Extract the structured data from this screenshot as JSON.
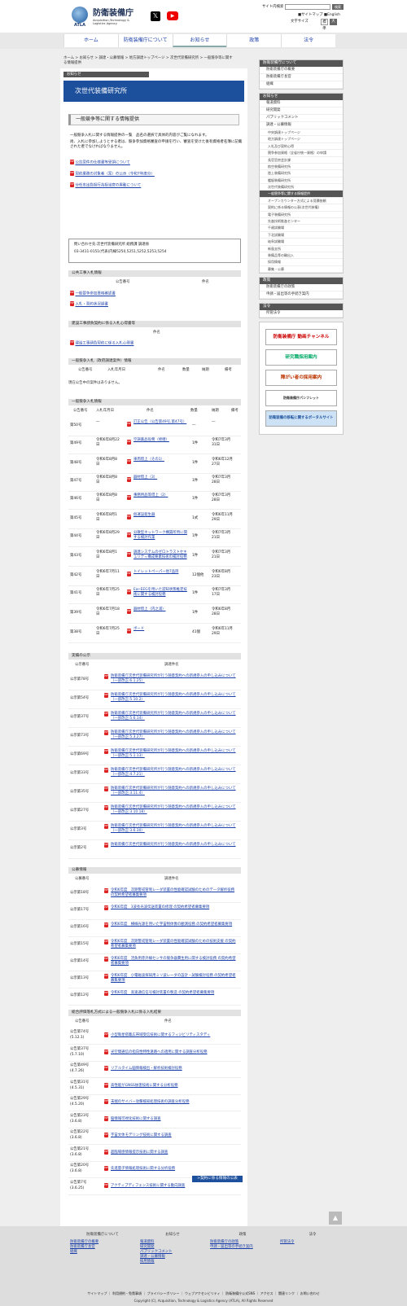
{
  "header": {
    "org_jp": "防衛装備庁",
    "org_en1": "Acquisition,Technology &",
    "org_en2": "Logistics Agency",
    "atla": "ATLA",
    "search_label": "サイト内検索",
    "search_btn": "検索",
    "sitemap": "サイトマップ",
    "english": "English",
    "fontsize_label": "文字サイズ",
    "fs_std": "標準",
    "fs_big": "大"
  },
  "nav": [
    "ホーム",
    "防衛装備庁について",
    "お知らせ",
    "政策",
    "法令"
  ],
  "breadcrumb": "ホーム > お知らせ > 調達・公募情報 > 地方調達トップページ > 次世代装備研究所 > 一般競争等に関する情報提供",
  "section_tab": "お知らせ",
  "banner_title": "次世代装備研究所",
  "page_title": "一般競争等に関する情報提供",
  "intro1": "一般競争入札に関する情報提供の一覧　品名の選択で具体的内容がご覧になれます。",
  "intro2": "尚、入札に参加しようとする者は、競争参加資格審査の申請を行い、審査を受けた後有資格者名簿に記載された者でなければなりません。",
  "links": [
    "公告案件の仕様書等受領について",
    "契約業務の対象者（案）の公示（令和7年度分）",
    "分任支出負担行為担当官の異動について"
  ],
  "contact1": "問い合わせ先:次世代装備研究所 総務課 調達係",
  "contact2": "03-3411-0151(代表)内線5250,5251,5252,5253,5254",
  "sec1": {
    "title": "公共工事入札情報",
    "h_no": "公告番号",
    "h_name": "件名",
    "links": [
      "一般競争参加資格確認書",
      "入札・契約状況調書"
    ]
  },
  "sec2": {
    "title": "建設工事請負契約に係る入札心得書等",
    "h_name": "件名",
    "links": [
      "建設工事請負契約に係る入札心得書"
    ]
  },
  "sec3": {
    "title": "一般競争入札（政府調達案件）情報",
    "heads": [
      "公告番号",
      "入札年月日",
      "件名",
      "数量",
      "納期",
      "備考"
    ],
    "none": "現在公告中の案件はありません。"
  },
  "sec4": {
    "title": "一般競争入札情報",
    "heads": [
      "公告番号",
      "入札年月日",
      "件名",
      "数量",
      "納期",
      "備考"
    ],
    "rows": [
      {
        "no": "第50号",
        "date": "―",
        "name": "訂正公告（公告第49号,第47号）",
        "qty": "―",
        "due": "―"
      },
      {
        "no": "第49号",
        "date": "令和6年8月22日",
        "name": "空調薬品役務（修繕）",
        "qty": "1件",
        "due": "令和7年3月31日"
      },
      {
        "no": "第48号",
        "date": "令和6年8月8日",
        "name": "車両借上（その1）",
        "qty": "1件",
        "due": "令和6年12月27日"
      },
      {
        "no": "第47号",
        "date": "令和6年8月8日",
        "name": "器材借上（3）",
        "qty": "1件",
        "due": "令和7年3月28日"
      },
      {
        "no": "第46号",
        "date": "令和6年8月8日",
        "name": "事務用品等借上（2）",
        "qty": "1件",
        "due": "令和7年3月28日"
      },
      {
        "no": "第45号",
        "date": "令和6年8月1日",
        "name": "仮運設発生器",
        "qty": "1式",
        "due": "令和6年11月29日"
      },
      {
        "no": "第44号",
        "date": "令和6年8月29日",
        "name": "分散型ネットワーク構築所用に関する検討作業",
        "qty": "1件",
        "due": "令和7年3月21日"
      },
      {
        "no": "第43号",
        "date": "令和6年8月1日",
        "name": "調達システムのゼロトラストセキュリティ構成要素技術の検討役務",
        "qty": "1件",
        "due": "令和7年3月21日"
      },
      {
        "no": "第42号",
        "date": "令和6年7月11日",
        "name": "トイレットペーパー他7品目",
        "qty": "12個他",
        "due": "令和6年8月23日"
      },
      {
        "no": "第41号",
        "date": "令和6年7月25日",
        "name": "Ear-EEGを用いた認知状態推定技術に関する検討役務",
        "qty": "1件",
        "due": "令和7年3月17日"
      },
      {
        "no": "第39号",
        "date": "令和6年7月18日",
        "name": "器材借上（内之浦）",
        "qty": "1件",
        "due": "令和6年8月28日"
      },
      {
        "no": "第38号",
        "date": "令和6年7月25日",
        "name": "ボード",
        "qty": "41個",
        "due": "令和6年11月29日"
      }
    ]
  },
  "sec5": {
    "title": "実績の公示",
    "heads": [
      "公示番号",
      "調達件名"
    ],
    "rows": [
      {
        "no": "公示第78号",
        "name": "防衛装備庁次世代装備研究所が行う随意契約への新規参入の申し込みについて（一部改正:6.1.25）"
      },
      {
        "no": "公示第54号",
        "name": "防衛装備庁次世代装備研究所が行う随意契約への新規参入の申し込みについて（一部改正:5.10.2）"
      },
      {
        "no": "公示第37号",
        "name": "防衛装備庁次世代装備研究所が行う随意契約への新規参入の申し込みについて（一部改正:5.6.14）"
      },
      {
        "no": "公示第73号",
        "name": "防衛装備庁次世代装備研究所が行う随意契約への新規参入の申し込みについて（一部改正:5.3.27）"
      },
      {
        "no": "公示第69号",
        "name": "防衛装備庁次世代装備研究所が行う随意契約への新規参入の申し込みについて（一部改正:5.1.13）"
      },
      {
        "no": "公示第33号",
        "name": "防衛装備庁次世代装備研究所が行う随意契約への新規参入の申し込みについて（一部改正:4.7.21）"
      },
      {
        "no": "公示第35号",
        "name": "防衛装備庁次世代装備研究所が行う随意契約への新規参入の申し込みについて（一部改正:3.11.4）"
      },
      {
        "no": "公示第27号",
        "name": "防衛装備庁次世代装備研究所が行う随意契約への新規参入の申し込みについて（一部改正:3.10.18）"
      },
      {
        "no": "公示第3号",
        "name": "防衛装備庁次世代装備研究所が行う随意契約への新規参入の申し込みについて（一部改正:3.6.30）"
      },
      {
        "no": "公示第2号",
        "name": "防衛装備庁次世代装備研究所が行う随意契約への新規参入の申し込みについて"
      }
    ]
  },
  "sec6": {
    "title": "公募情報",
    "heads": [
      "公募番号",
      "調達件名"
    ],
    "rows": [
      {
        "no": "公示第18号",
        "name": "令和6年度　次期警戒管制レーダ装置の性能確認試験のためのデータ解析役務 の契約希望者募集要項"
      },
      {
        "no": "公示第17号",
        "name": "令和6年度　3波長光波伝送装置の修理 の契約希望者募集要項"
      },
      {
        "no": "公示第16号",
        "name": "令和6年度　横線光源を用いた宇宙物体像の観測役務 の契約希望者募集要項"
      },
      {
        "no": "公示第15号",
        "name": "令和6年度　次期警戒管制レーダ装置の性能確認試験のための技術支援 の契約希望者募集要項"
      },
      {
        "no": "公示第14号",
        "name": "令和6年度　活魚用赤外線センサの競争器費生用に関する検討役務 の契約希望者募集要項"
      },
      {
        "no": "公示第13号",
        "name": "令和6年度　小電磁波探知用ミリ波レーダの設計・試験検討役務 の契約希望者募集要項"
      },
      {
        "no": "公示第12号",
        "name": "令和6年度　高速通信信号検討装置の製造 の契約希望者募集要項"
      }
    ]
  },
  "sec7": {
    "title": "総合評価落札方式による一般競争入札に係る入札結果",
    "heads": [
      "公告番号",
      "件名"
    ],
    "rows": [
      {
        "no": "公告第74号",
        "date": "(5.12.1)",
        "name": "小型衛星搭載広帯域受信技術に関するフィジビリティスタディ"
      },
      {
        "no": "公告第37号",
        "date": "(5.7.10)",
        "name": "光空間通信の指向性特性遠路への適用に関する調査分析役務"
      },
      {
        "no": "公告第49号",
        "date": "(4.7.26)",
        "name": "リアルタイム脳情報検出・解析技術検討役務"
      },
      {
        "no": "公告第31号",
        "date": "(4.5.31)",
        "name": "高性能がGNSS妨害技術に関する分析役務"
      },
      {
        "no": "公告第29号",
        "date": "(4.5.20)",
        "name": "末端のサイバー攻撃検知処理技術の調査分析役務"
      },
      {
        "no": "公告第23号",
        "date": "(3.6.8)",
        "name": "脳情報可視化技術に関する調査"
      },
      {
        "no": "公告第22号",
        "date": "(3.6.8)",
        "name": "字宙文体モデリング技術に関する調査"
      },
      {
        "no": "公告第21号",
        "date": "(3.6.8)",
        "name": "超臨場感情報提示技術に関する調査"
      },
      {
        "no": "公告第20号",
        "date": "(3.6.8)",
        "name": "先進量子情報処理技術に関する分析役務"
      },
      {
        "no": "公告第7号",
        "date": "(3.6.25)",
        "name": "アクティブディフェンス技術に関する動向調査"
      }
    ]
  },
  "contract_btn": ">契約に係る情報の公表",
  "sidebar": {
    "about": {
      "title": "防衛装備庁について",
      "items": [
        "防衛装備庁の概要",
        "防衛装備庁長官",
        "組織"
      ]
    },
    "news": {
      "title": "お知らせ",
      "items": [
        "報道資料",
        "研究開発",
        "パブリックコメント",
        "調達・公募情報"
      ],
      "sub": [
        "中央調達トップページ",
        "地方調達トップページ",
        "入札及び契約心得",
        "競争参加資格（全省庁統一資格）の申請",
        "長官官房会計課",
        "航空装備研究所",
        "陸上装備研究所",
        "艦艇装備研究所",
        "次世代装備研究所",
        "一般競争等に関する情報提供",
        "オープンカウンター方式による見積依頼",
        "契約に係る情報の公表(次世代装備)",
        "電子装備研究所",
        "先進技術推進センター",
        "千歳試験場",
        "下北試験場",
        "岐阜試験場",
        "新島支所",
        "装備品等の輸出入",
        "採用情報",
        "募集・公募"
      ],
      "selected": "一般競争等に関する情報提供"
    },
    "policy": {
      "title": "政策",
      "items": [
        "防衛装備庁の政策",
        "申請・届出等の手続き案内"
      ]
    },
    "law": {
      "title": "法令",
      "items": [
        "所管法令"
      ]
    },
    "banners": [
      "防衛装備庁 動画チャンネル",
      "研究職採用案内",
      "障がい者の採用案内",
      "防衛装備庁パンフレット",
      "防衛装備の移転に関するポータルサイト"
    ]
  },
  "footer": {
    "cols": [
      {
        "title": "防衛装備庁について",
        "items": [
          "防衛装備庁の概要",
          "防衛装備庁長官",
          "組織"
        ]
      },
      {
        "title": "お知らせ",
        "items": [
          "報道資料",
          "研究開発",
          "パブリックコメント",
          "調達・公募情報",
          "採用情報"
        ]
      },
      {
        "title": "政策",
        "items": [
          "防衛装備庁の政策",
          "申請・届出等の手続き案内"
        ]
      },
      {
        "title": "法令",
        "items": [
          "所管法令"
        ]
      }
    ],
    "links": "サイトマップ ｜ 利用規約・免責事項 ｜ プライバシーポリシー ｜ ウェブアクセシビリティ ｜ 防衛装備庁公式SNS ｜ アクセス ｜ 関連リンク ｜ お問い合わせ",
    "copyright": "Copyright (C), Acquisition, Technology & Logistics Agency (ATLA), All Rights Reserved"
  },
  "pagetop": "▲"
}
